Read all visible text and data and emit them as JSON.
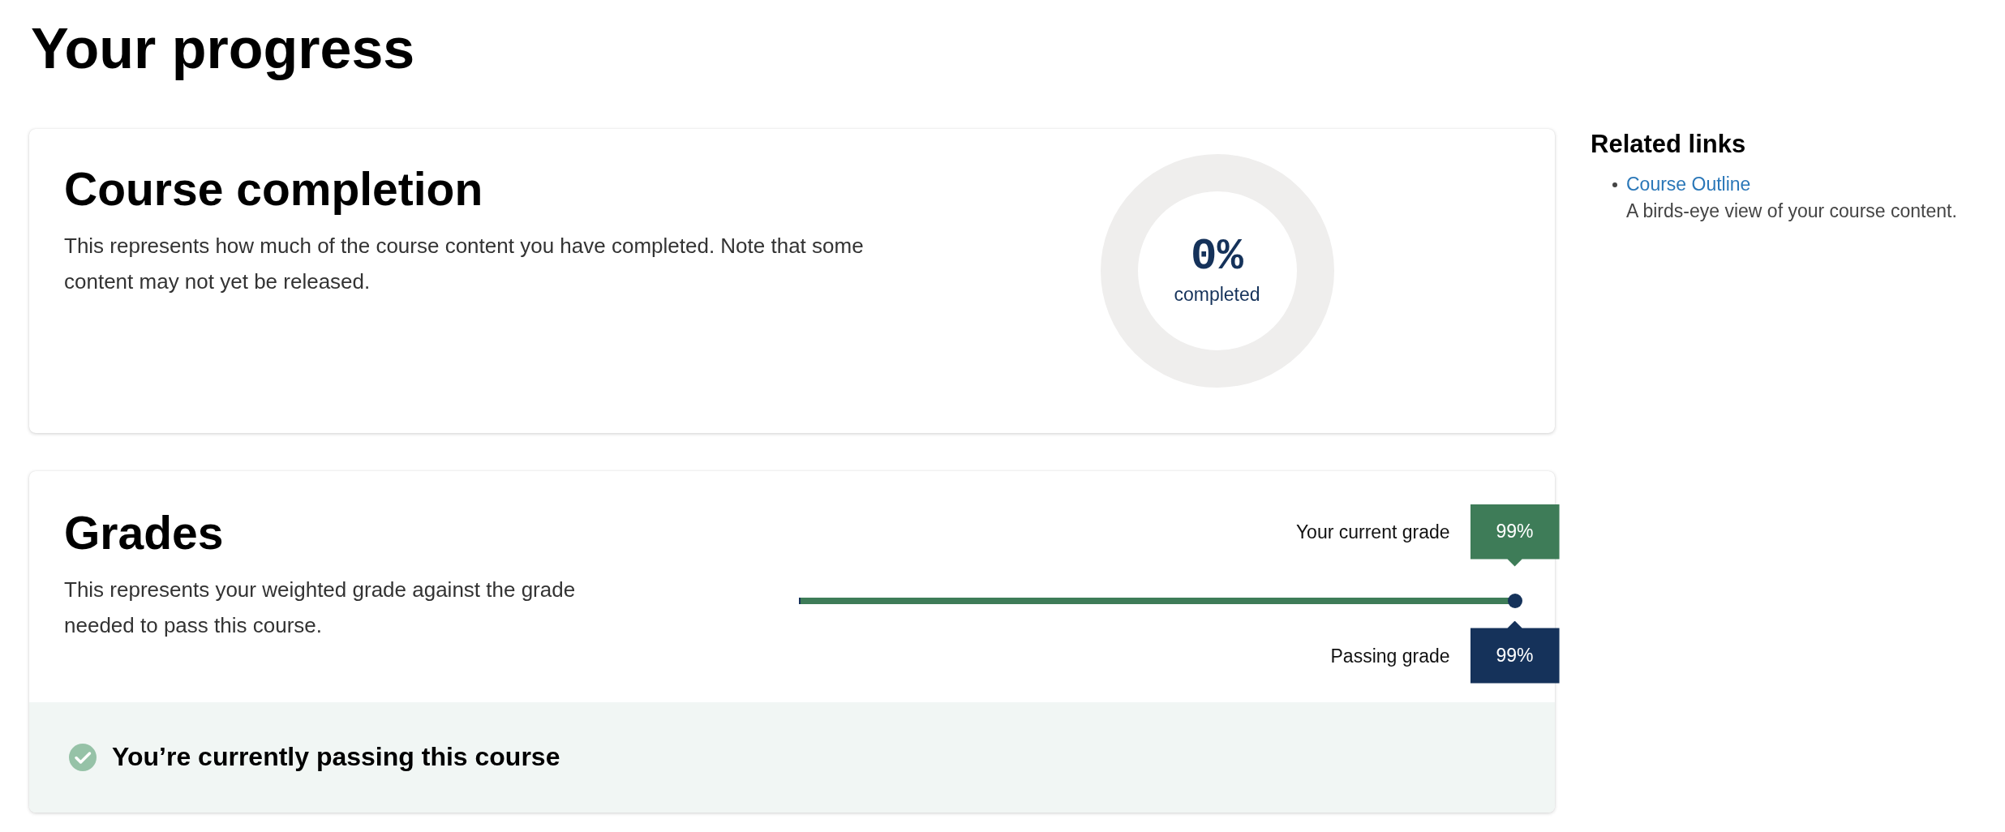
{
  "page": {
    "title": "Your progress"
  },
  "completion": {
    "heading": "Course completion",
    "description": "This represents how much of the course content you have completed. Note that some content may not yet be released.",
    "percent": "0%",
    "caption": "completed"
  },
  "grades": {
    "heading": "Grades",
    "description": "This represents your weighted grade against the grade needed to pass this course.",
    "current": {
      "label": "Your current grade",
      "value": "99%",
      "level": 0.99
    },
    "passing": {
      "label": "Passing grade",
      "value": "99%",
      "level": 0.99
    },
    "status": {
      "passing": true,
      "message": "You’re currently passing this course"
    }
  },
  "related": {
    "heading": "Related links",
    "links": [
      {
        "label": "Course Outline",
        "description": "A birds-eye view of your course content."
      }
    ]
  }
}
